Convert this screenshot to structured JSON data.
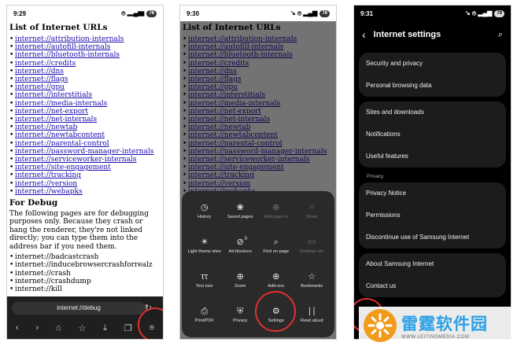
{
  "phone1": {
    "status": {
      "time": "9:29",
      "icons": "⚙ ●",
      "signal": "⦺ ▂▄▆",
      "battery": "78"
    },
    "page": {
      "title": "List of Internet URLs",
      "links": [
        "internet://attribution-internals",
        "internet://autofill-internals",
        "internet://bluetooth-internals",
        "internet://credits",
        "internet://dns",
        "internet://flags",
        "internet://gpu",
        "internet://interstitials",
        "internet://media-internals",
        "internet://net-export",
        "internet://net-internals",
        "internet://newtab",
        "internet://newtabcontent",
        "internet://parental-control",
        "internet://password-manager-internals",
        "internet://serviceworker-internals",
        "internet://site-engagement",
        "internet://tracking",
        "internet://version",
        "internet://webapks"
      ],
      "debug_heading": "For Debug",
      "debug_text": "The following pages are for debugging purposes only. Because they crash or hang the renderer, they're not linked directly; you can type them into the address bar if you need them.",
      "debug_items": [
        "internet://badcastcrash",
        "internet://inducebrowsercrashforrealz",
        "internet://crash",
        "internet://crashdump",
        "internet://kill"
      ]
    },
    "address_bar": {
      "url": "internet://debug"
    }
  },
  "phone2": {
    "status": {
      "time": "9:30",
      "icons": "⚙ ▣",
      "signal": "↘ ⦺ ▂▄▆",
      "battery": "78"
    },
    "menu_items": [
      {
        "icon": "◷",
        "label": "History",
        "name": "history",
        "disabled": false
      },
      {
        "icon": "❀",
        "label": "Saved pages",
        "name": "saved-pages",
        "disabled": false
      },
      {
        "icon": "⊕",
        "label": "Add page to",
        "name": "add-page-to",
        "disabled": true
      },
      {
        "icon": "⑂",
        "label": "Share",
        "name": "share",
        "disabled": true
      },
      {
        "icon": "☀",
        "label": "Light theme sites",
        "name": "light-theme-sites",
        "disabled": false
      },
      {
        "icon": "⊘",
        "label": "Ad blockers",
        "name": "ad-blockers",
        "badge": "0",
        "disabled": false
      },
      {
        "icon": "⌕",
        "label": "Find on page",
        "name": "find-on-page",
        "disabled": false
      },
      {
        "icon": "▭",
        "label": "Desktop site",
        "name": "desktop-site",
        "disabled": true
      },
      {
        "icon": "ττ",
        "label": "Text size",
        "name": "text-size",
        "disabled": false
      },
      {
        "icon": "⊕",
        "label": "Zoom",
        "name": "zoom",
        "disabled": false
      },
      {
        "icon": "⊕",
        "label": "Add-ons",
        "name": "add-ons",
        "disabled": false
      },
      {
        "icon": "☆",
        "label": "Bookmarks",
        "name": "bookmarks",
        "disabled": false
      },
      {
        "icon": "⎙",
        "label": "Print/PDF",
        "name": "print-pdf",
        "disabled": false
      },
      {
        "icon": "⛨",
        "label": "Privacy",
        "name": "privacy",
        "disabled": false
      },
      {
        "icon": "⚙",
        "label": "Settings",
        "name": "settings",
        "disabled": false
      },
      {
        "icon": "∣∣",
        "label": "Read aloud",
        "name": "read-aloud",
        "disabled": false
      }
    ]
  },
  "phone3": {
    "status": {
      "time": "9:31",
      "icons": "⚙ ♥ ●",
      "signal": "↘ ⦺ ▂▄▆",
      "battery": "78"
    },
    "header": {
      "back": "‹",
      "title": "Internet settings",
      "search": "⌕"
    },
    "group1": [
      "Security and privacy",
      "Personal browsing data"
    ],
    "group2": [
      "Sites and downloads",
      "Notifications",
      "Useful features"
    ],
    "privacy_label": "Privacy",
    "group3": [
      "Privacy Notice",
      "Permissions",
      "Discontinue use of Samsung Internet"
    ],
    "group4": [
      "About Samsung Internet",
      "Contact us"
    ]
  },
  "watermark": {
    "cn": "雷霆软件园",
    "url": "WWW.LEITINGMEDIA.COM"
  },
  "colors": {
    "link": "#1a0dab",
    "highlight": "#e03030",
    "watermark_text": "#2ba0e6",
    "watermark_logo": "#f29a1a"
  }
}
